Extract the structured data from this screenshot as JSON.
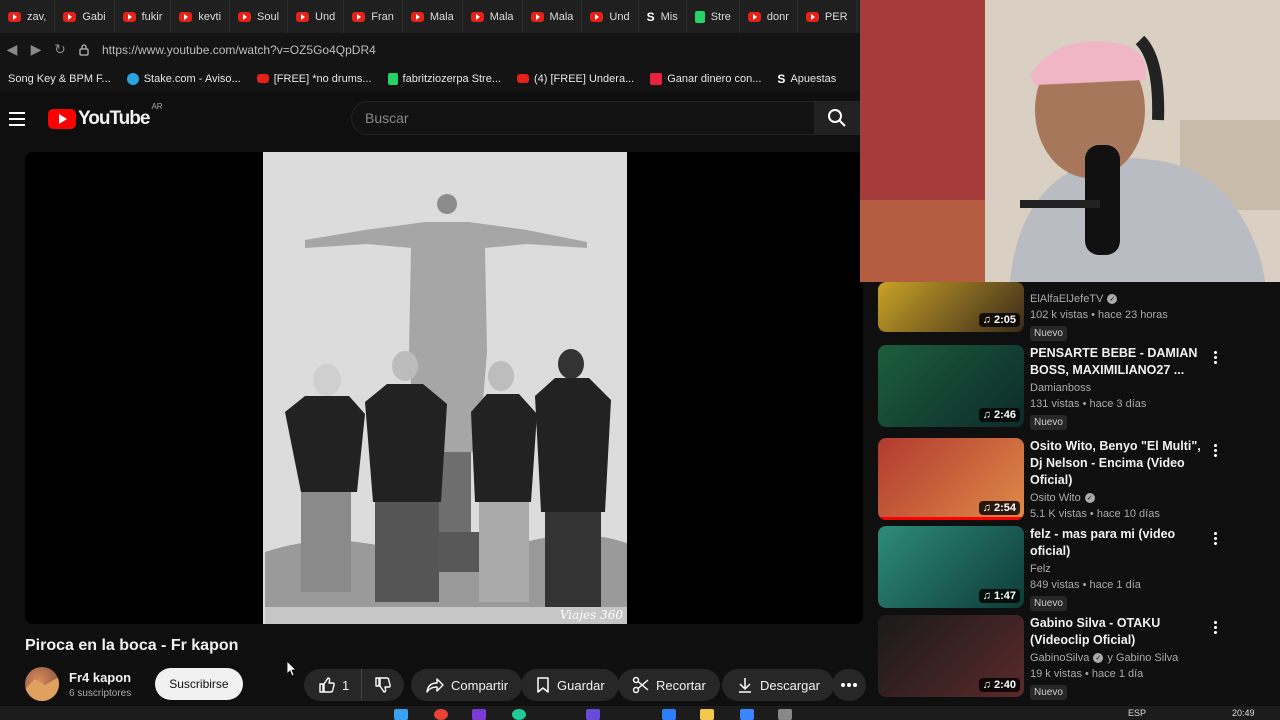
{
  "browser": {
    "tabs": [
      {
        "label": "zav,",
        "icon": "youtube-icon"
      },
      {
        "label": "Gabi",
        "icon": "youtube-icon"
      },
      {
        "label": "fukir",
        "icon": "youtube-icon"
      },
      {
        "label": "kevti",
        "icon": "youtube-icon"
      },
      {
        "label": "Soul",
        "icon": "youtube-icon"
      },
      {
        "label": "Und",
        "icon": "youtube-icon"
      },
      {
        "label": "Fran",
        "icon": "youtube-icon"
      },
      {
        "label": "Mala",
        "icon": "youtube-icon"
      },
      {
        "label": "Mala",
        "icon": "youtube-icon"
      },
      {
        "label": "Mala",
        "icon": "youtube-icon"
      },
      {
        "label": "Und",
        "icon": "youtube-icon"
      },
      {
        "label": "Mis",
        "icon": "stake-icon"
      },
      {
        "label": "Stre",
        "icon": "kick-icon"
      },
      {
        "label": "donr",
        "icon": "youtube-icon"
      },
      {
        "label": "PER",
        "icon": "youtube-icon"
      }
    ],
    "url": "https://www.youtube.com/watch?v=OZ5Go4QpDR4",
    "bookmarks": [
      {
        "label": "Song Key & BPM F...",
        "icon": "none"
      },
      {
        "label": "Stake.com - Aviso...",
        "icon": "telegram-icon"
      },
      {
        "label": "[FREE] *no drums...",
        "icon": "youtube-icon"
      },
      {
        "label": "fabritziozerpa Stre...",
        "icon": "kick-icon"
      },
      {
        "label": "(4) [FREE] Undera...",
        "icon": "youtube-icon"
      },
      {
        "label": "Ganar dinero con...",
        "icon": "patreon-icon"
      },
      {
        "label": "Apuestas",
        "icon": "stake-icon"
      }
    ]
  },
  "youtube": {
    "logo_text": "YouTube",
    "country_code": "AR",
    "search_placeholder": "Buscar"
  },
  "video": {
    "watermark": "Viajes 360",
    "title": "Piroca en la boca - Fr kapon",
    "channel_name": "Fr4 kapon",
    "subscribers": "6 suscriptores",
    "subscribe_label": "Suscribirse",
    "like_count": "1",
    "share_label": "Compartir",
    "save_label": "Guardar",
    "clip_label": "Recortar",
    "download_label": "Descargar"
  },
  "sidebar": {
    "items": [
      {
        "title": "",
        "channel": "ElAlfaElJefeTV",
        "verified": true,
        "views": "102 k vistas • hace 23 horas",
        "badge": "Nuevo",
        "duration": "2:05"
      },
      {
        "title": "PENSARTE BEBE - DAMIAN BOSS, MAXIMILIANO27 ...",
        "channel": "Damianboss",
        "verified": false,
        "views": "131 vistas • hace 3 días",
        "badge": "Nuevo",
        "duration": "2:46"
      },
      {
        "title": "Osito Wito, Benyo \"El Multi\", Dj Nelson - Encima (Video Oficial)",
        "channel": "Osito Wito",
        "verified": true,
        "views": "5.1 K vistas • hace 10 días",
        "badge": "",
        "duration": "2:54"
      },
      {
        "title": "felz - mas para mi (video oficial)",
        "channel": "Felz",
        "verified": false,
        "views": "849 vistas • hace 1 día",
        "badge": "Nuevo",
        "duration": "1:47"
      },
      {
        "title": "Gabino Silva - OTAKU (Videoclip Oficial)",
        "channel": "GabinoSilva",
        "channel_extra": "y Gabino Silva",
        "verified": true,
        "views": "19 k vistas • hace 1 día",
        "badge": "Nuevo",
        "duration": "2:40"
      }
    ]
  },
  "taskbar": {
    "lang": "ESP",
    "time": "20:49"
  }
}
